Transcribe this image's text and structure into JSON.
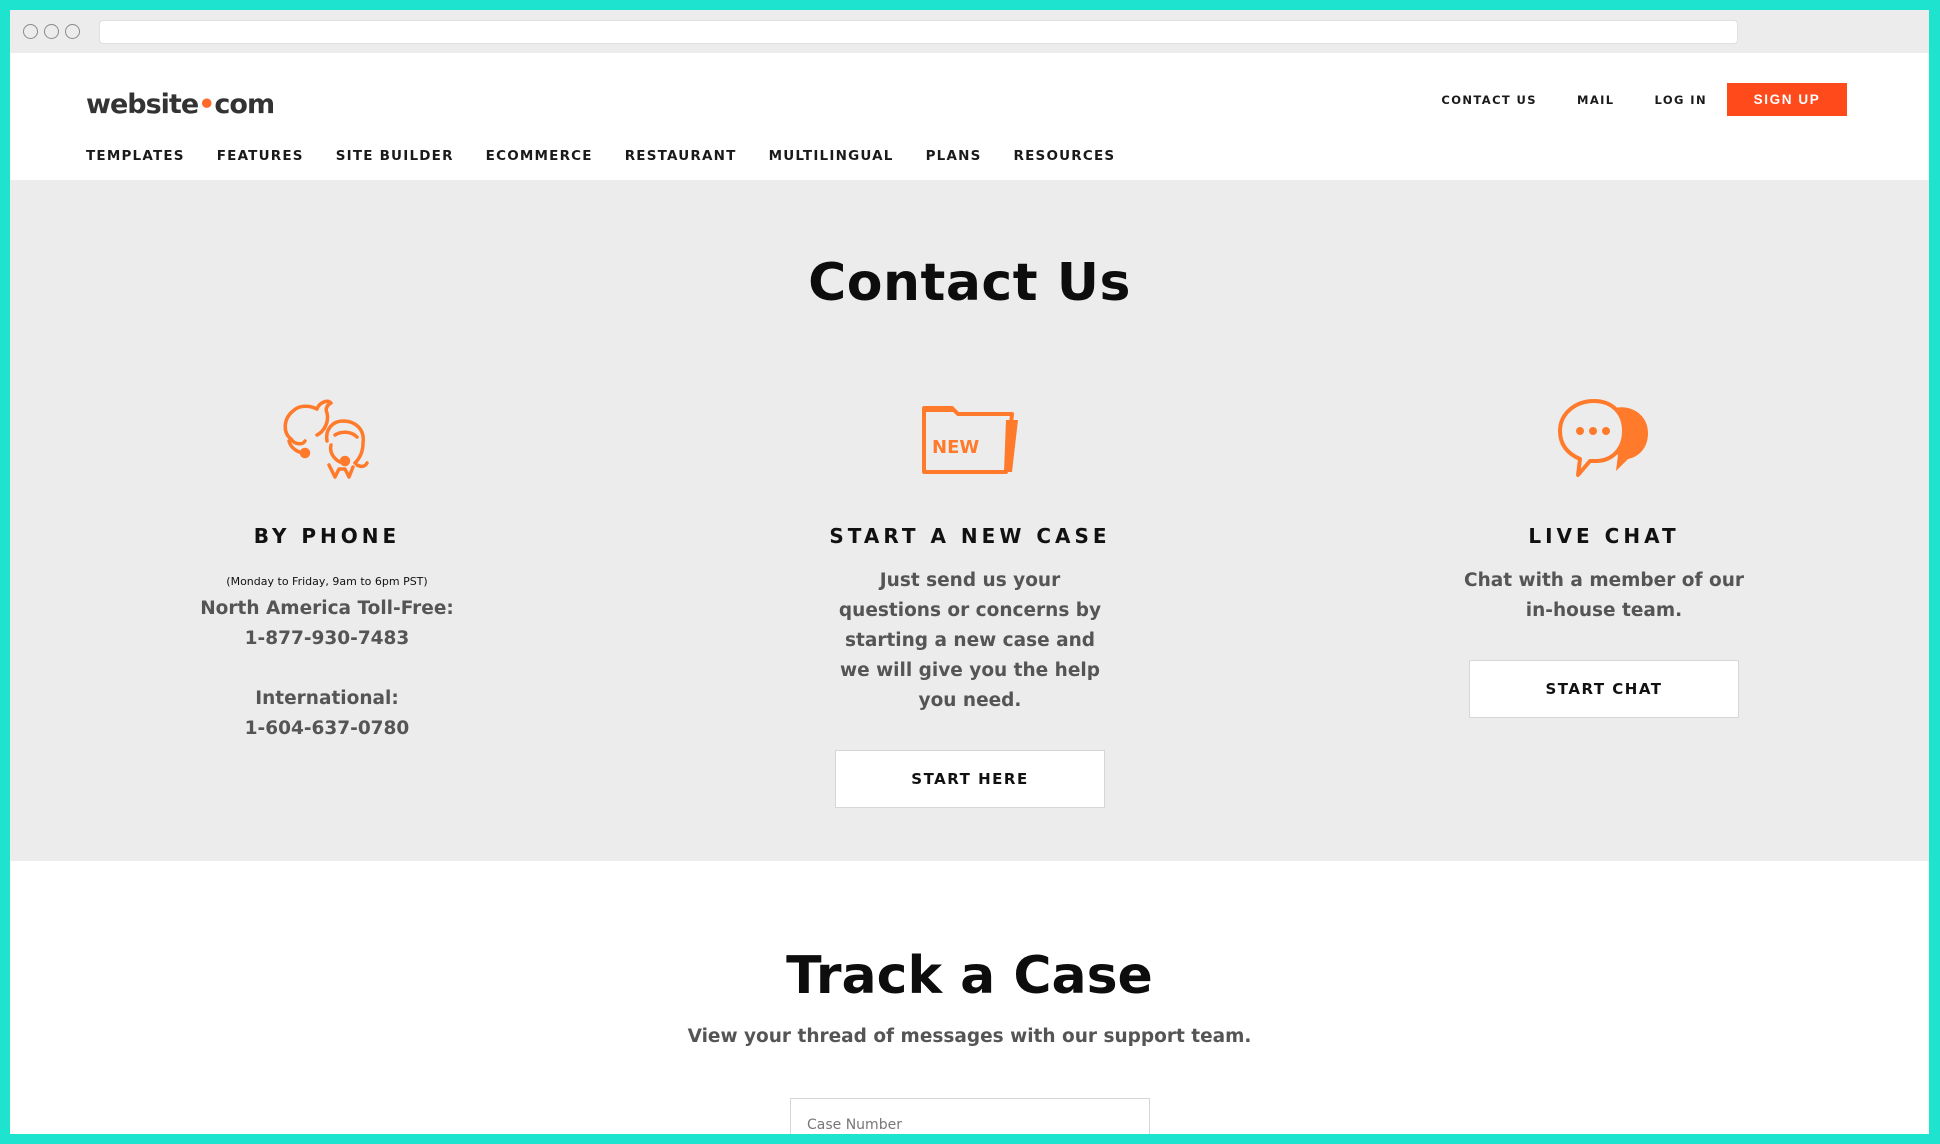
{
  "browser": {
    "url": ""
  },
  "header": {
    "logo": {
      "part1": "website",
      "part2": "com"
    },
    "top_links": [
      "CONTACT US",
      "MAIL",
      "LOG IN"
    ],
    "signup_label": "SIGN UP",
    "nav": [
      "TEMPLATES",
      "FEATURES",
      "SITE BUILDER",
      "ECOMMERCE",
      "RESTAURANT",
      "MULTILINGUAL",
      "PLANS",
      "RESOURCES"
    ]
  },
  "contact": {
    "title": "Contact Us",
    "phone": {
      "heading": "BY PHONE",
      "hours": "(Monday to Friday, 9am to 6pm PST)",
      "na_label": "North America Toll-Free:",
      "na_number": "1-877-930-7483",
      "intl_label": "International:",
      "intl_number": "1-604-637-0780"
    },
    "newcase": {
      "heading": "START A NEW CASE",
      "icon_text": "NEW",
      "body": "Just send us your questions or concerns by starting a new case and we will give you the help you need.",
      "button": "START HERE"
    },
    "chat": {
      "heading": "LIVE CHAT",
      "body": "Chat with a member of our in-house team.",
      "button": "START CHAT"
    }
  },
  "track": {
    "title": "Track a Case",
    "subtitle": "View your thread of messages with our support team.",
    "case_placeholder": "Case Number"
  },
  "colors": {
    "accent": "#ff4a1c",
    "icon": "#ff7a2a",
    "teal_border": "#1ee3cf"
  }
}
